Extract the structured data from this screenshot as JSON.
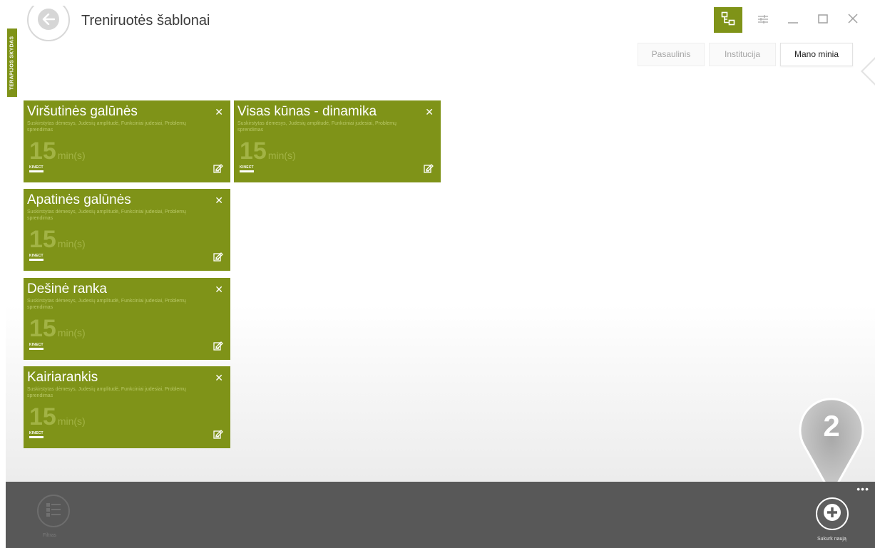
{
  "side_tab": {
    "label": "TERAPIJOS SKYDAS"
  },
  "header": {
    "title": "Treniruotės šablonai"
  },
  "tabs": [
    {
      "label": "Pasaulinis",
      "active": false
    },
    {
      "label": "Institucija",
      "active": false
    },
    {
      "label": "Mano minia",
      "active": true
    }
  ],
  "cards": [
    {
      "title": "Viršutinės galūnės",
      "desc": "Suskirstytas dėmesys, Judesių amplitudė, Funkciniai judesiai, Problemų sprendimas",
      "duration": "15",
      "unit": "min(s)",
      "device": "KINECT"
    },
    {
      "title": "Visas kūnas - dinamika",
      "desc": "Suskirstytas dėmesys, Judesių amplitudė, Funkciniai judesiai, Problemų sprendimas",
      "duration": "15",
      "unit": "min(s)",
      "device": "KINECT"
    },
    {
      "title": "Apatinės galūnės",
      "desc": "Suskirstytas dėmesys, Judesių amplitudė, Funkciniai judesiai, Problemų sprendimas",
      "duration": "15",
      "unit": "min(s)",
      "device": "KINECT"
    },
    {
      "title": "Dešinė ranka",
      "desc": "Suskirstytas dėmesys, Judesių amplitudė, Funkciniai judesiai, Problemų sprendimas",
      "duration": "15",
      "unit": "min(s)",
      "device": "KINECT"
    },
    {
      "title": "Kairiarankis",
      "desc": "Suskirstytas dėmesys, Judesių amplitudė, Funkciniai judesiai, Problemų sprendimas",
      "duration": "15",
      "unit": "min(s)",
      "device": "KINECT"
    }
  ],
  "bottom_bar": {
    "filter_label": "Filtras",
    "create_label": "Sukurk naują",
    "more": "•••"
  },
  "callout": {
    "number": "2"
  },
  "colors": {
    "accent": "#7f9318",
    "bottom_bar": "#585858"
  },
  "icons": {
    "back": "arrow-left-icon",
    "tree": "tree-structure-icon",
    "settings": "sliders-icon",
    "minimize": "minimize-icon",
    "maximize": "maximize-icon",
    "close": "close-icon",
    "card_close": "x-icon",
    "edit": "edit-note-icon",
    "filter": "list-filter-icon",
    "create": "plus-icon"
  }
}
